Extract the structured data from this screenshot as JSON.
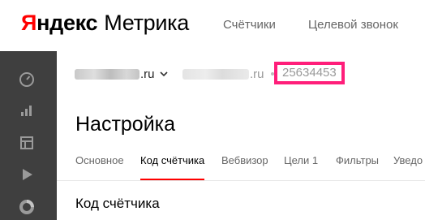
{
  "header": {
    "logo_brand_first": "Я",
    "logo_brand_rest": "ндекс",
    "logo_product": "Метрика",
    "nav": [
      {
        "label": "Счётчики"
      },
      {
        "label": "Целевой звонок"
      }
    ]
  },
  "sidebar": {
    "icons": [
      "dashboard-icon",
      "reports-icon",
      "maps-icon",
      "webvisor-icon",
      "segments-icon"
    ]
  },
  "site_bar": {
    "site_domain_suffix": ".ru",
    "mirror_domain_suffix": ".ru",
    "counter_id": "25634453",
    "highlight_color": "#ff1e7a"
  },
  "page": {
    "title": "Настройка",
    "tabs": [
      {
        "label": "Основное",
        "active": false
      },
      {
        "label": "Код счётчика",
        "active": true
      },
      {
        "label": "Вебвизор",
        "active": false
      },
      {
        "label": "Цели 1",
        "active": false
      },
      {
        "label": "Фильтры",
        "active": false
      },
      {
        "label": "Уведо",
        "active": false
      }
    ],
    "section_title": "Код счётчика"
  },
  "colors": {
    "brand": "#ff0000",
    "sidebar": "#3f3f3f",
    "active_tab_underline": "#ff0000"
  }
}
